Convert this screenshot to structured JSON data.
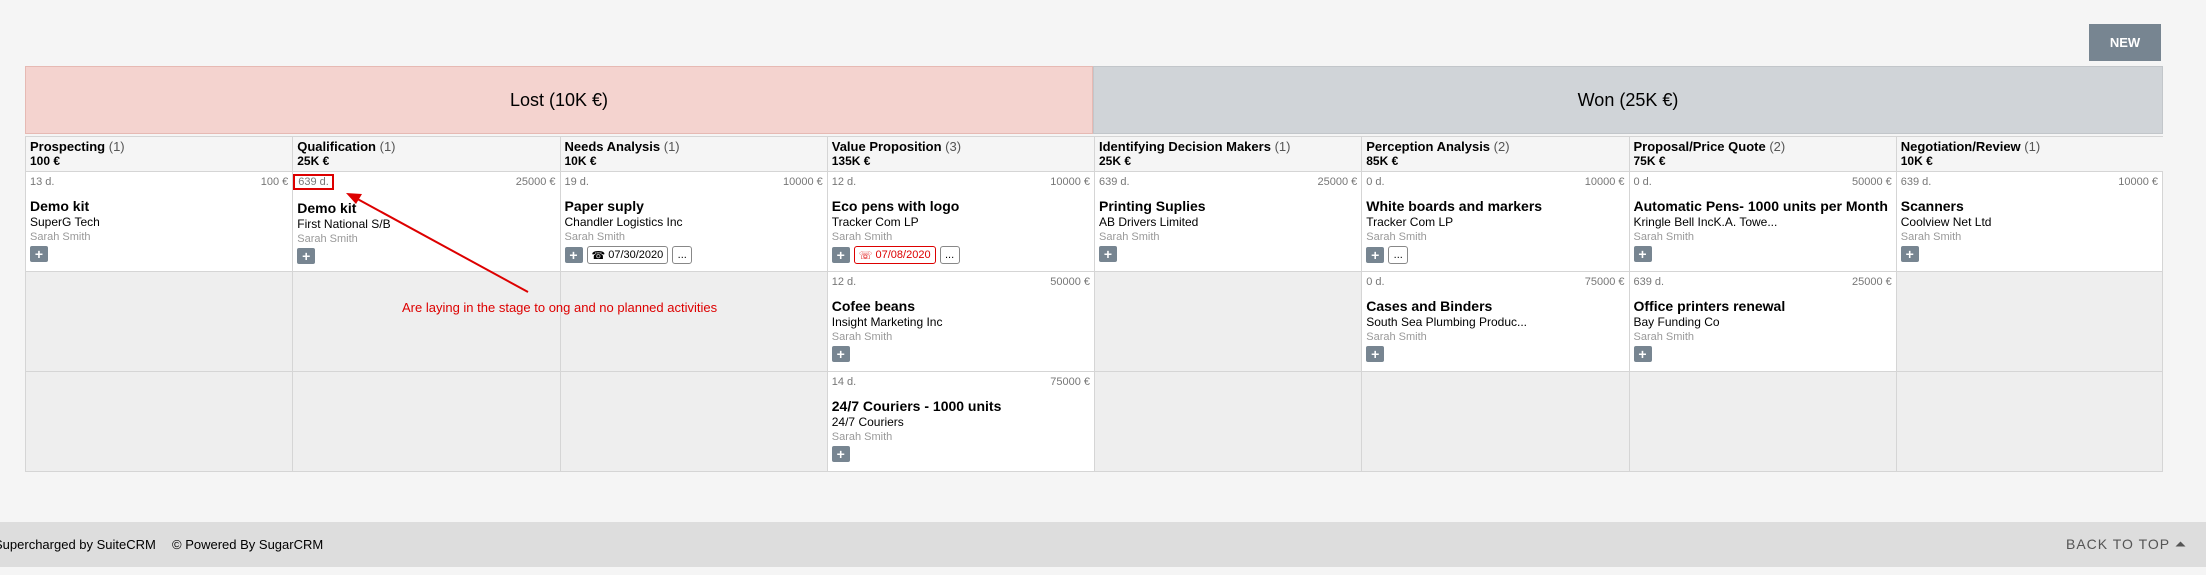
{
  "toolbar": {
    "new_label": "NEW"
  },
  "groups": [
    {
      "label": "Lost (10K €)"
    },
    {
      "label": "Won (25K €)"
    }
  ],
  "stages": [
    {
      "name": "Prospecting",
      "count": "(1)",
      "sum": "100 €"
    },
    {
      "name": "Qualification",
      "count": "(1)",
      "sum": "25K €"
    },
    {
      "name": "Needs Analysis",
      "count": "(1)",
      "sum": "10K €"
    },
    {
      "name": "Value Proposition",
      "count": "(3)",
      "sum": "135K €"
    },
    {
      "name": "Identifying Decision Makers",
      "count": "(1)",
      "sum": "25K €"
    },
    {
      "name": "Perception Analysis",
      "count": "(2)",
      "sum": "85K €"
    },
    {
      "name": "Proposal/Price Quote",
      "count": "(2)",
      "sum": "75K €"
    },
    {
      "name": "Negotiation/Review",
      "count": "(1)",
      "sum": "10K €"
    }
  ],
  "cards": {
    "r0c0": {
      "days": "13 d.",
      "amount": "100 €",
      "title": "Demo kit",
      "account": "SuperG Tech",
      "user": "Sarah Smith"
    },
    "r0c1": {
      "days": "639 d.",
      "amount": "25000 €",
      "title": "Demo kit",
      "account": "First National S/B",
      "user": "Sarah Smith"
    },
    "r0c2": {
      "days": "19 d.",
      "amount": "10000 €",
      "title": "Paper suply",
      "account": "Chandler Logistics Inc",
      "user": "Sarah Smith",
      "date": "07/30/2020",
      "more": "..."
    },
    "r0c3": {
      "days": "12 d.",
      "amount": "10000 €",
      "title": "Eco pens with logo",
      "account": "Tracker Com LP",
      "user": "Sarah Smith",
      "date": "07/08/2020",
      "more": "..."
    },
    "r0c4": {
      "days": "639 d.",
      "amount": "25000 €",
      "title": "Printing Suplies",
      "account": "AB Drivers Limited",
      "user": "Sarah Smith"
    },
    "r0c5": {
      "days": "0 d.",
      "amount": "10000 €",
      "title": "White boards and markers",
      "account": "Tracker Com LP",
      "user": "Sarah Smith",
      "more": "..."
    },
    "r0c6": {
      "days": "0 d.",
      "amount": "50000 €",
      "title": "Automatic Pens- 1000 units per Month",
      "account": "Kringle Bell IncK.A. Towe...",
      "user": "Sarah Smith"
    },
    "r0c7": {
      "days": "639 d.",
      "amount": "10000 €",
      "title": "Scanners",
      "account": "Coolview Net Ltd",
      "user": "Sarah Smith"
    },
    "r1c3": {
      "days": "12 d.",
      "amount": "50000 €",
      "title": "Cofee beans",
      "account": "Insight Marketing Inc",
      "user": "Sarah Smith"
    },
    "r1c5": {
      "days": "0 d.",
      "amount": "75000 €",
      "title": "Cases and Binders",
      "account": "South Sea Plumbing Produc...",
      "user": "Sarah Smith"
    },
    "r1c6": {
      "days": "639 d.",
      "amount": "25000 €",
      "title": "Office printers renewal",
      "account": "Bay Funding Co",
      "user": "Sarah Smith"
    },
    "r2c3": {
      "days": "14 d.",
      "amount": "75000 €",
      "title": "24/7 Couriers - 1000 units",
      "account": "24/7 Couriers",
      "user": "Sarah Smith"
    }
  },
  "annotation": {
    "text": "Are laying in the stage to ong and no planned activities"
  },
  "footer": {
    "supercharged": "Supercharged by SuiteCRM",
    "powered": "© Powered By SugarCRM",
    "back_to_top": "BACK TO TOP ⏶"
  },
  "colors": {
    "lost": "#f4d3cf",
    "won": "#d0d4d8",
    "button": "#778591",
    "annotation": "#dd0000"
  }
}
